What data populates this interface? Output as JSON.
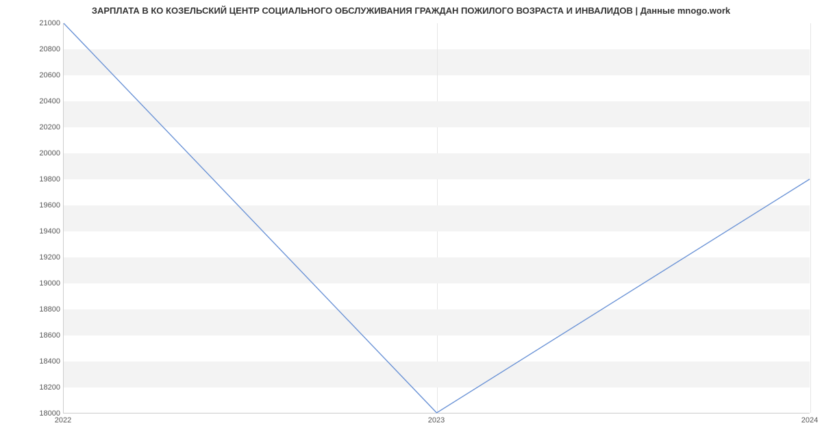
{
  "chart_data": {
    "type": "line",
    "title": "ЗАРПЛАТА В КО КОЗЕЛЬСКИЙ ЦЕНТР СОЦИАЛЬНОГО ОБСЛУЖИВАНИЯ ГРАЖДАН ПОЖИЛОГО ВОЗРАСТА И ИНВАЛИДОВ | Данные mnogo.work",
    "x": [
      "2022",
      "2023",
      "2024"
    ],
    "values": [
      21000,
      18000,
      19800
    ],
    "y_ticks": [
      18000,
      18200,
      18400,
      18600,
      18800,
      19000,
      19200,
      19400,
      19600,
      19800,
      20000,
      20200,
      20400,
      20600,
      20800,
      21000
    ],
    "x_ticks": [
      "2022",
      "2023",
      "2024"
    ],
    "ylim": [
      18000,
      21000
    ],
    "line_color": "#6b93d6"
  }
}
